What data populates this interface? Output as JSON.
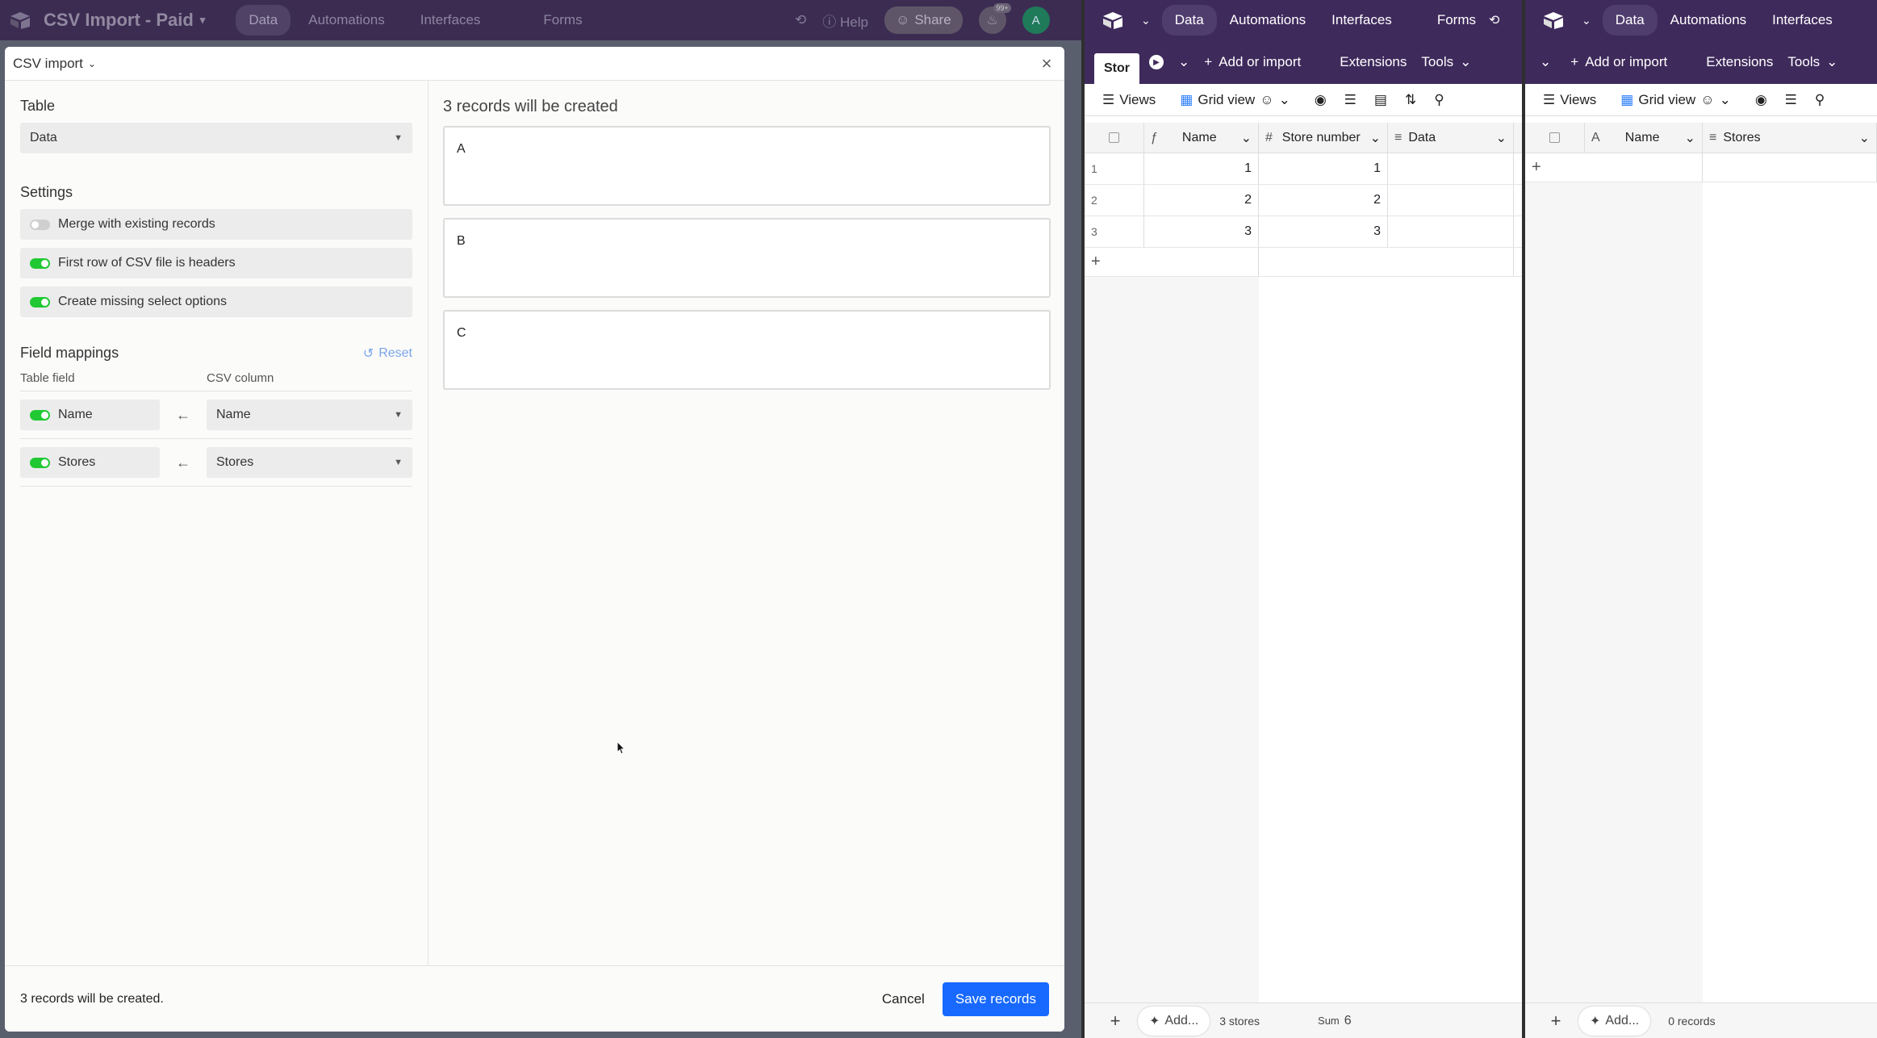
{
  "left_app": {
    "base_name": "CSV Import - Paid",
    "nav": [
      "Data",
      "Automations",
      "Interfaces",
      "Forms"
    ],
    "help": "Help",
    "share": "Share",
    "notif_badge": "99+",
    "avatar": "A"
  },
  "dialog": {
    "title": "CSV import",
    "table_label": "Table",
    "table_value": "Data",
    "settings_label": "Settings",
    "settings": [
      {
        "label": "Merge with existing records",
        "on": false
      },
      {
        "label": "First row of CSV file is headers",
        "on": true
      },
      {
        "label": "Create missing select options",
        "on": true
      }
    ],
    "field_mappings_label": "Field mappings",
    "reset_label": "Reset",
    "col_table_field": "Table field",
    "col_csv_column": "CSV column",
    "mappings": [
      {
        "field": "Name",
        "column": "Name"
      },
      {
        "field": "Stores",
        "column": "Stores"
      }
    ],
    "preview_title": "3 records will be created",
    "records": [
      "A",
      "B",
      "C"
    ],
    "footer_text": "3 records will be created.",
    "cancel_label": "Cancel",
    "save_label": "Save records"
  },
  "middle_app": {
    "nav": [
      "Data",
      "Automations",
      "Interfaces",
      "Forms"
    ],
    "tab_label": "Stor",
    "add_or_import": "Add or import",
    "extensions": "Extensions",
    "tools": "Tools",
    "views": "Views",
    "grid_view": "Grid view",
    "columns": [
      "Name",
      "Store number",
      "Data"
    ],
    "rows": [
      {
        "n": "1",
        "name": "1",
        "store": "1"
      },
      {
        "n": "2",
        "name": "2",
        "store": "2"
      },
      {
        "n": "3",
        "name": "3",
        "store": "3"
      }
    ],
    "add_label": "Add...",
    "record_count": "3 stores",
    "sum_label": "Sum",
    "sum_value": "6"
  },
  "right_app": {
    "nav": [
      "Data",
      "Automations",
      "Interfaces"
    ],
    "add_or_import": "Add or import",
    "extensions": "Extensions",
    "tools": "Tools",
    "views": "Views",
    "grid_view": "Grid view",
    "columns": [
      "Name",
      "Stores"
    ],
    "add_label": "Add...",
    "record_count": "0 records"
  },
  "colors": {
    "toggle_on": "#20c933",
    "save_button": "#1769ff",
    "header_purple": "#3f2a5c"
  }
}
